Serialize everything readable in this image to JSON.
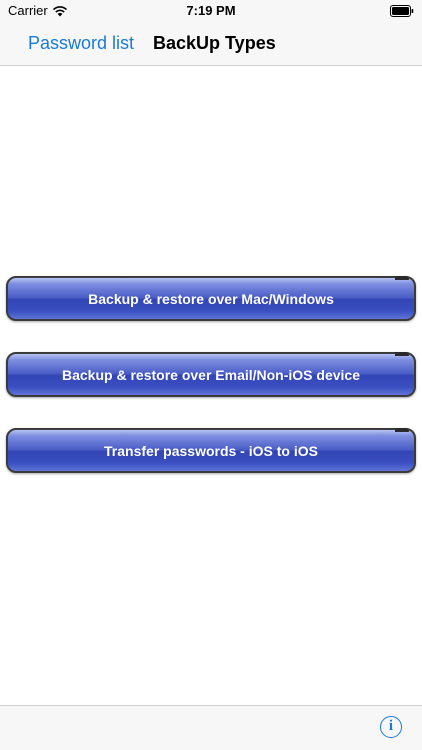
{
  "status_bar": {
    "carrier": "Carrier",
    "time": "7:19 PM",
    "wifi_icon": "wifi-icon",
    "battery_icon": "battery-icon"
  },
  "nav_bar": {
    "back_label": "Password list",
    "title": "BackUp Types"
  },
  "buttons": [
    {
      "label": "Backup & restore over Mac/Windows"
    },
    {
      "label": "Backup & restore over Email/Non-iOS device"
    },
    {
      "label": "Transfer passwords - iOS to iOS"
    }
  ],
  "toolbar": {
    "info_icon": "info-icon",
    "info_glyph": "i"
  },
  "colors": {
    "accent": "#1a7ad8",
    "button_blue": "#4a5dc6",
    "bar_background": "#f7f7f7"
  }
}
